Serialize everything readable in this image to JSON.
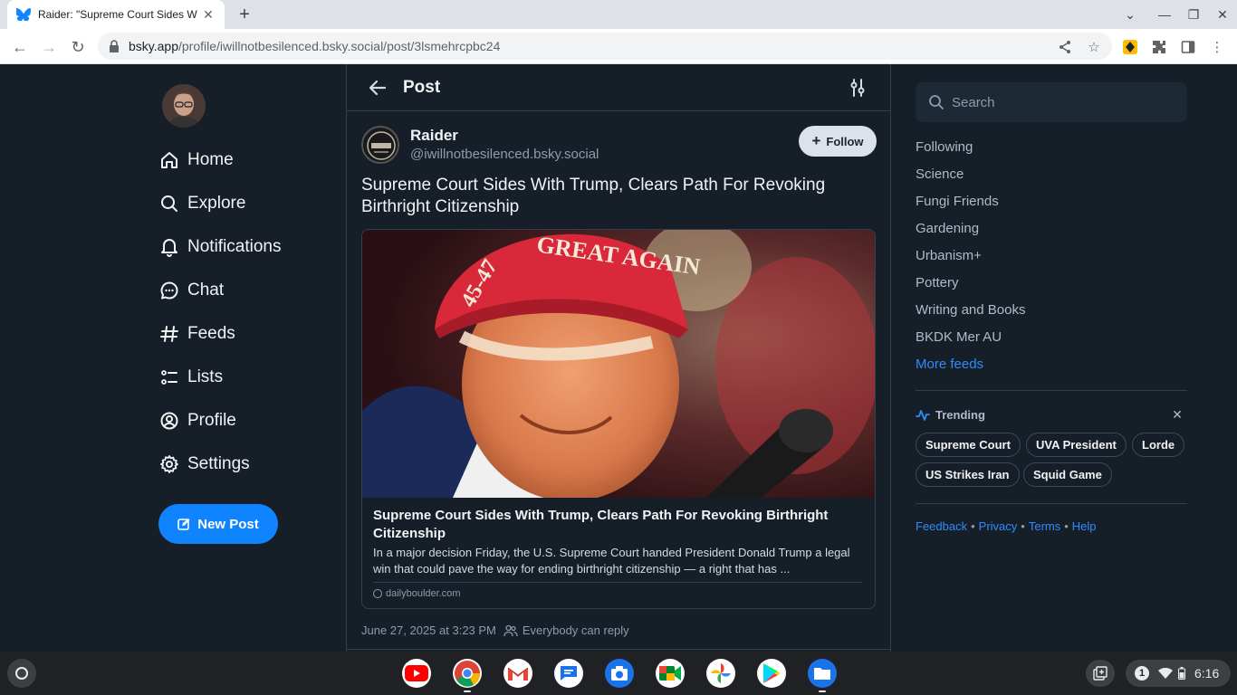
{
  "browser": {
    "tab_title": "Raider: \"Supreme Court Sides Wi",
    "url_host": "bsky.app",
    "url_path": "/profile/iwillnotbesilenced.bsky.social/post/3lsmehrcpbc24"
  },
  "nav": {
    "items": [
      {
        "label": "Home",
        "icon": "home-icon"
      },
      {
        "label": "Explore",
        "icon": "search-icon"
      },
      {
        "label": "Notifications",
        "icon": "bell-icon"
      },
      {
        "label": "Chat",
        "icon": "chat-icon"
      },
      {
        "label": "Feeds",
        "icon": "hash-icon"
      },
      {
        "label": "Lists",
        "icon": "list-icon"
      },
      {
        "label": "Profile",
        "icon": "profile-icon"
      },
      {
        "label": "Settings",
        "icon": "gear-icon"
      }
    ],
    "new_post": "New Post"
  },
  "post": {
    "header_title": "Post",
    "author_name": "Raider",
    "author_handle": "@iwillnotbesilenced.bsky.social",
    "follow_label": "Follow",
    "text": "Supreme Court Sides With Trump, Clears Path For Revoking Birthright Citizenship",
    "card": {
      "title": "Supreme Court Sides With Trump, Clears Path For Revoking Birthright Citizenship",
      "description": "In a major decision Friday, the U.S. Supreme Court handed President Donald Trump a legal win that could pave the way for ending birthright citizenship — a right that has ...",
      "domain": "dailyboulder.com",
      "image_caption_text": "GREAT AGAIN",
      "image_hat_number": "45-47"
    },
    "timestamp": "June 27, 2025 at 3:23 PM",
    "reply_setting": "Everybody can reply"
  },
  "sidebar": {
    "search_placeholder": "Search",
    "feeds": [
      "Following",
      "Science",
      "Fungi Friends",
      "Gardening",
      "Urbanism+",
      "Pottery",
      "Writing and Books",
      "BKDK Mer AU"
    ],
    "more_feeds": "More feeds",
    "trending_title": "Trending",
    "trending": [
      "Supreme Court",
      "UVA President",
      "Lorde",
      "US Strikes Iran",
      "Squid Game"
    ],
    "footer": [
      "Feedback",
      "Privacy",
      "Terms",
      "Help"
    ]
  },
  "shelf": {
    "notification_count": "1",
    "time": "6:16"
  },
  "colors": {
    "accent": "#1083fe",
    "link": "#2e8cfe",
    "background": "#161e27",
    "border": "#2e4052"
  }
}
